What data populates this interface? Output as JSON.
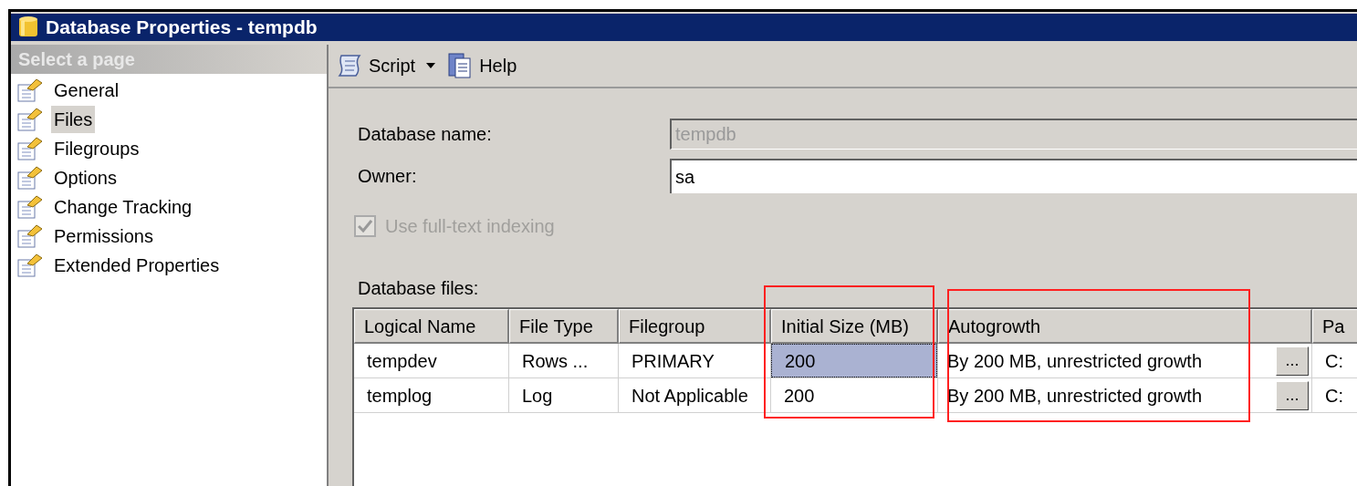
{
  "window": {
    "title": "Database Properties - tempdb"
  },
  "sidebar": {
    "header": "Select a page",
    "items": [
      {
        "label": "General",
        "selected": false
      },
      {
        "label": "Files",
        "selected": true
      },
      {
        "label": "Filegroups",
        "selected": false
      },
      {
        "label": "Options",
        "selected": false
      },
      {
        "label": "Change Tracking",
        "selected": false
      },
      {
        "label": "Permissions",
        "selected": false
      },
      {
        "label": "Extended Properties",
        "selected": false
      }
    ]
  },
  "toolbar": {
    "script": "Script",
    "help": "Help"
  },
  "form": {
    "database_name": {
      "label": "Database name:",
      "value": "tempdb",
      "disabled": true
    },
    "owner": {
      "label": "Owner:",
      "value": "sa",
      "disabled": false
    },
    "fulltext": {
      "label": "Use full-text indexing",
      "checked": true,
      "disabled": true
    }
  },
  "files": {
    "label": "Database files:",
    "columns": [
      "Logical Name",
      "File Type",
      "Filegroup",
      "Initial Size (MB)",
      "Autogrowth",
      "Pa"
    ],
    "rows": [
      {
        "cells": [
          "tempdev",
          "Rows ...",
          "PRIMARY",
          "200",
          "By 200 MB, unrestricted growth",
          "C:"
        ],
        "selected": true
      },
      {
        "cells": [
          "templog",
          "Log",
          "Not Applicable",
          "200",
          "By 200 MB, unrestricted growth",
          "C:"
        ],
        "selected": false
      }
    ],
    "browse_button": "..."
  }
}
